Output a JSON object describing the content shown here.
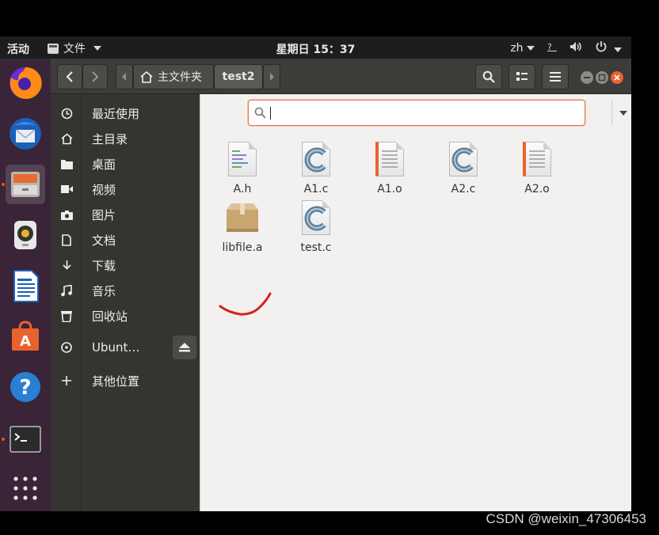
{
  "topbar": {
    "activities": "活动",
    "app_menu": "文件",
    "clock": "星期日 15：37",
    "input_method": "zh"
  },
  "dock": {
    "items": [
      "firefox-icon",
      "thunderbird-icon",
      "files-icon",
      "rhythmbox-icon",
      "writer-icon",
      "software-icon",
      "help-icon",
      "terminal-icon",
      "show-apps-icon"
    ]
  },
  "headerbar": {
    "home_crumb": "主文件夹",
    "current_crumb": "test2"
  },
  "sidebar": {
    "items": [
      {
        "label": "最近使用",
        "icon": "clock-icon"
      },
      {
        "label": "主目录",
        "icon": "home-icon"
      },
      {
        "label": "桌面",
        "icon": "folder-icon"
      },
      {
        "label": "视频",
        "icon": "video-icon"
      },
      {
        "label": "图片",
        "icon": "camera-icon"
      },
      {
        "label": "文档",
        "icon": "document-icon"
      },
      {
        "label": "下载",
        "icon": "download-icon"
      },
      {
        "label": "音乐",
        "icon": "music-icon"
      },
      {
        "label": "回收站",
        "icon": "trash-icon"
      },
      {
        "label": "Ubunt…",
        "icon": "disc-icon"
      },
      {
        "label": "其他位置",
        "icon": "plus-icon"
      }
    ]
  },
  "search": {
    "value": "",
    "placeholder": ""
  },
  "files": [
    {
      "name": "A.h",
      "type": "header-file-icon"
    },
    {
      "name": "A1.c",
      "type": "c-source-icon"
    },
    {
      "name": "A1.o",
      "type": "object-file-icon"
    },
    {
      "name": "A2.c",
      "type": "c-source-icon"
    },
    {
      "name": "A2.o",
      "type": "object-file-icon"
    },
    {
      "name": "libfile.a",
      "type": "archive-icon"
    },
    {
      "name": "test.c",
      "type": "c-source-icon"
    }
  ],
  "watermark": "CSDN @weixin_47306453",
  "colors": {
    "accent": "#e95420",
    "annotation": "#d81e1e",
    "panel": "#1d1d1d",
    "sidebar": "#353430"
  }
}
